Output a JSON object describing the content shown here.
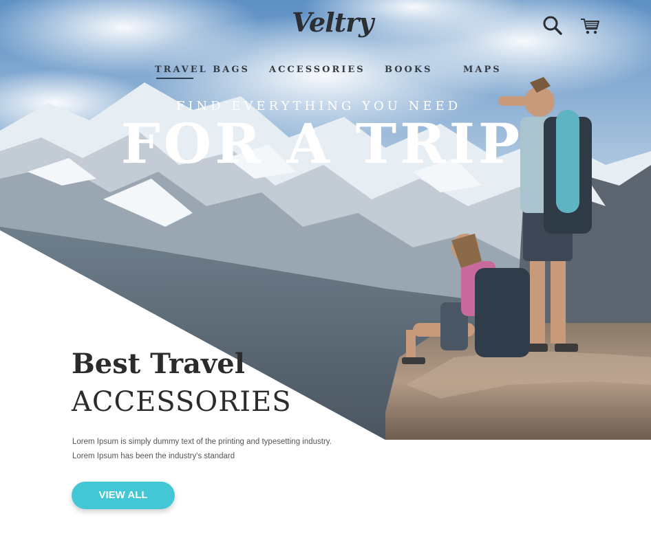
{
  "brand": {
    "name": "Veltry",
    "accent_color": "#44c7d5"
  },
  "header": {
    "search_icon": "search-icon",
    "cart_icon": "shopping-cart-icon"
  },
  "nav": {
    "items": [
      {
        "label": "TRAVEL BAGS",
        "active": true
      },
      {
        "label": "ACCESSORIES",
        "active": false
      },
      {
        "label": "BOOKS",
        "active": false
      },
      {
        "label": "MAPS",
        "active": false
      }
    ]
  },
  "hero": {
    "tagline": "FIND EVERYTHING YOU NEED",
    "title": "FOR A TRIP"
  },
  "section": {
    "title_line1": "Best Travel",
    "title_line2": "ACCESSORIES",
    "description_line1": "Lorem Ipsum is simply dummy text of the printing and typesetting industry.",
    "description_line2": "Lorem Ipsum has been the industry's standard",
    "button_label": "VIEW ALL"
  }
}
